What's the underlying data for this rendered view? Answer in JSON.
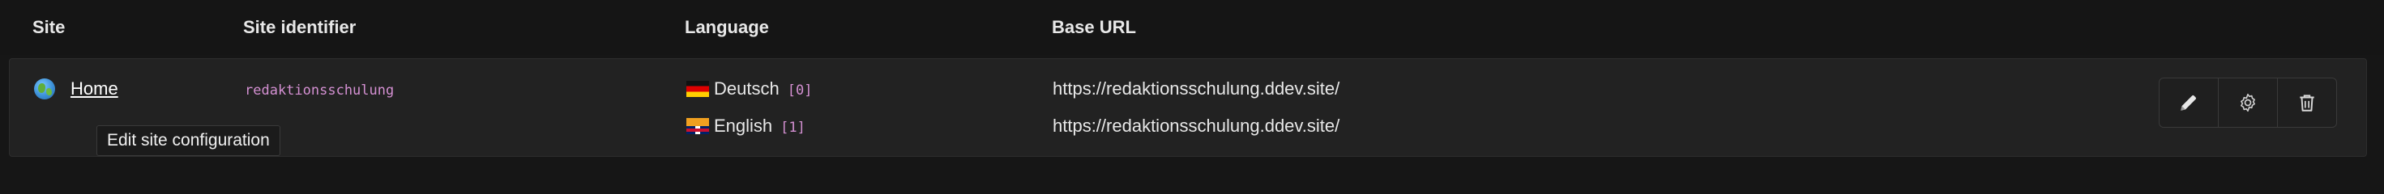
{
  "table": {
    "columns": [
      "Site",
      "Site identifier",
      "Language",
      "Base URL"
    ],
    "row": {
      "site_label": "Home",
      "site_identifier": "redaktionsschulung",
      "languages": [
        {
          "name": "Deutsch",
          "id": "[0]",
          "flag": "de-flag-icon",
          "base_url": "https://redaktionsschulung.ddev.site/"
        },
        {
          "name": "English",
          "id": "[1]",
          "flag": "en-flag-icon",
          "base_url": "https://redaktionsschulung.ddev.site/"
        }
      ],
      "actions": [
        {
          "name": "edit",
          "icon": "pencil-icon"
        },
        {
          "name": "configure",
          "icon": "gear-icon"
        },
        {
          "name": "delete",
          "icon": "trash-icon"
        }
      ]
    }
  },
  "tooltip": {
    "text": "Edit site configuration"
  },
  "colors": {
    "background": "#161616",
    "row_background": "#222222",
    "identifier_accent": "#d490d2"
  }
}
